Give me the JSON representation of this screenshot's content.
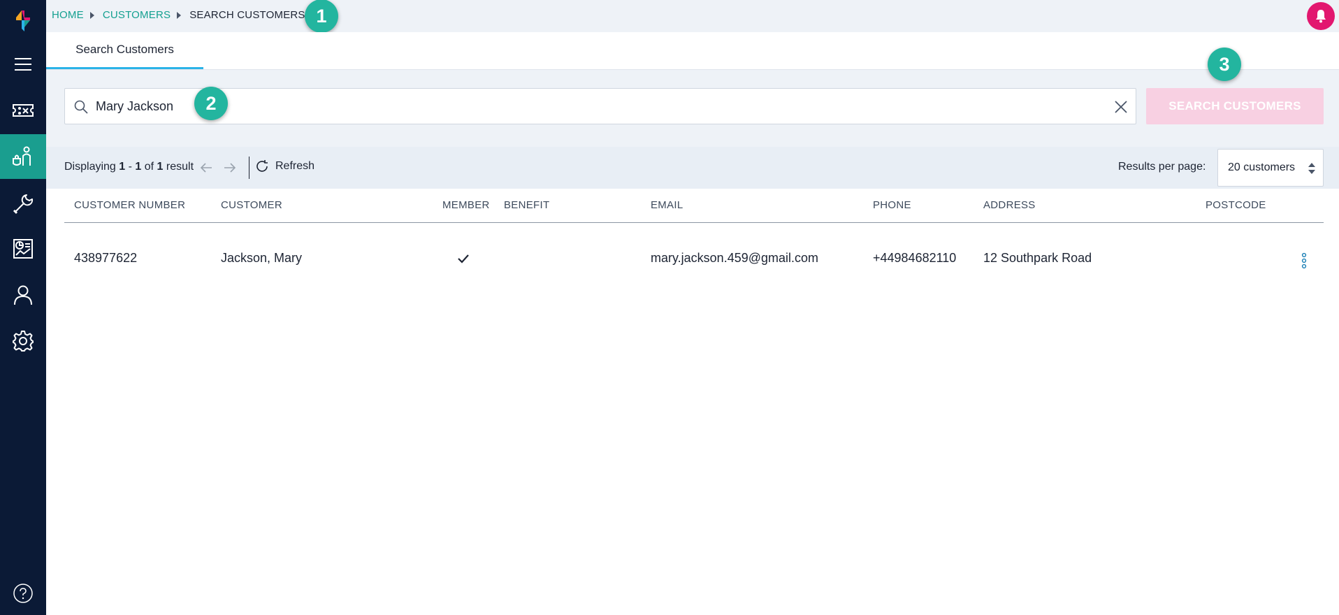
{
  "breadcrumb": {
    "home": "HOME",
    "customers": "CUSTOMERS",
    "current": "SEARCH CUSTOMERS"
  },
  "markers": [
    "1",
    "2",
    "3"
  ],
  "tabs": [
    {
      "label": "Search Customers",
      "active": true
    }
  ],
  "search": {
    "value": "Mary Jackson",
    "button_label": "SEARCH CUSTOMERS"
  },
  "toolbar": {
    "displaying_prefix": "Displaying",
    "range_start": "1",
    "range_sep": " - ",
    "range_end": "1",
    "of_text": " of ",
    "total": "1",
    "result_word": " result",
    "refresh_label": "Refresh",
    "results_per_page_label": "Results per page:",
    "results_per_page_value": "20 customers"
  },
  "table": {
    "columns": [
      "CUSTOMER NUMBER",
      "CUSTOMER",
      "MEMBER",
      "BENEFIT",
      "EMAIL",
      "PHONE",
      "ADDRESS",
      "POSTCODE"
    ],
    "rows": [
      {
        "customer_number": "438977622",
        "customer": "Jackson, Mary",
        "member": true,
        "benefit": "",
        "email": "mary.jackson.459@gmail.com",
        "phone": "+44984682110",
        "address": "12 Southpark Road",
        "postcode": ""
      }
    ]
  },
  "colors": {
    "sidebar_bg": "#0b1a36",
    "accent_teal": "#1a9e8f",
    "marker": "#23b59f",
    "bell": "#e2176f",
    "search_button_disabled": "#f8d0e2",
    "tab_underline": "#2bb3e8"
  },
  "sidebar": {
    "items": [
      {
        "icon": "menu-icon",
        "active": false
      },
      {
        "icon": "ticket-icon",
        "active": false
      },
      {
        "icon": "customer-service-icon",
        "active": true
      },
      {
        "icon": "wrench-icon",
        "active": false
      },
      {
        "icon": "report-icon",
        "active": false
      },
      {
        "icon": "user-icon",
        "active": false
      },
      {
        "icon": "gear-icon",
        "active": false
      }
    ],
    "footer_icon": "help-icon"
  }
}
